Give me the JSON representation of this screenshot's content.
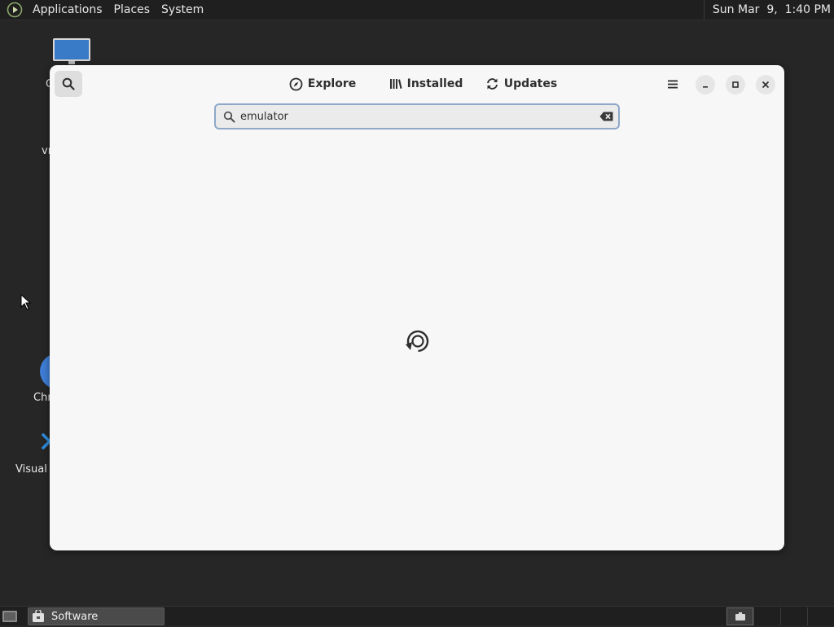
{
  "top_panel": {
    "menus": [
      "Applications",
      "Places",
      "System"
    ],
    "clock": "Sun Mar  9,  1:40 PM"
  },
  "desktop": {
    "icons": [
      {
        "icon": "monitor-icon",
        "label": "C"
      },
      {
        "icon": "folder-icon",
        "label": "vr"
      },
      {
        "icon": "chrome-icon",
        "label": "Chr"
      },
      {
        "icon": "vscode-icon",
        "label": "Visual S"
      }
    ]
  },
  "window": {
    "tabs": [
      {
        "label": "Explore",
        "icon": "compass-icon"
      },
      {
        "label": "Installed",
        "icon": "library-icon"
      },
      {
        "label": "Updates",
        "icon": "refresh-icon"
      }
    ],
    "search": {
      "value": "emulator",
      "placeholder": ""
    },
    "loading_icon": "spinner-icon"
  },
  "taskbar": {
    "items": [
      {
        "label": "Software",
        "icon": "software-bag-icon"
      }
    ]
  },
  "colors": {
    "panel_bg": "#1f1f1f",
    "desktop_bg": "#262626",
    "window_bg": "#f7f7f7",
    "focus_ring": "#8ea8c9"
  }
}
